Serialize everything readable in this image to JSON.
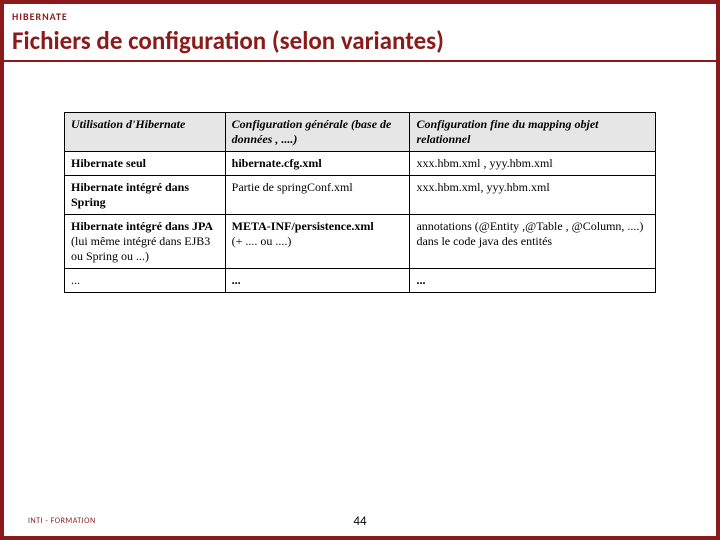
{
  "header": {
    "small_title": "HIBERNATE",
    "main_title": "Fichiers de configuration (selon variantes)"
  },
  "table": {
    "headers": [
      "Utilisation d'Hibernate",
      "Configuration générale (base de données , ....)",
      "Configuration fine du mapping objet relationnel"
    ],
    "rows": [
      {
        "c0_head": "Hibernate seul",
        "c0_sub": "",
        "c1": "hibernate.cfg.xml",
        "c2": "xxx.hbm.xml , yyy.hbm.xml"
      },
      {
        "c0_head": "Hibernate intégré dans Spring",
        "c0_sub": "",
        "c1": "Partie de springConf.xml",
        "c2": "xxx.hbm.xml, yyy.hbm.xml"
      },
      {
        "c0_head": "Hibernate intégré dans JPA",
        "c0_sub": "(lui même intégré dans EJB3 ou Spring ou ...)",
        "c1": "META-INF/persistence.xml (+ .... ou ....)",
        "c2": "annotations  (@Entity ,@Table ,  @Column, ....) dans le code java des entités"
      },
      {
        "c0_head": "...",
        "c0_sub": "",
        "c1": "...",
        "c2": "..."
      }
    ]
  },
  "footer": {
    "org": "INTI - FORMATION",
    "page": "44"
  }
}
